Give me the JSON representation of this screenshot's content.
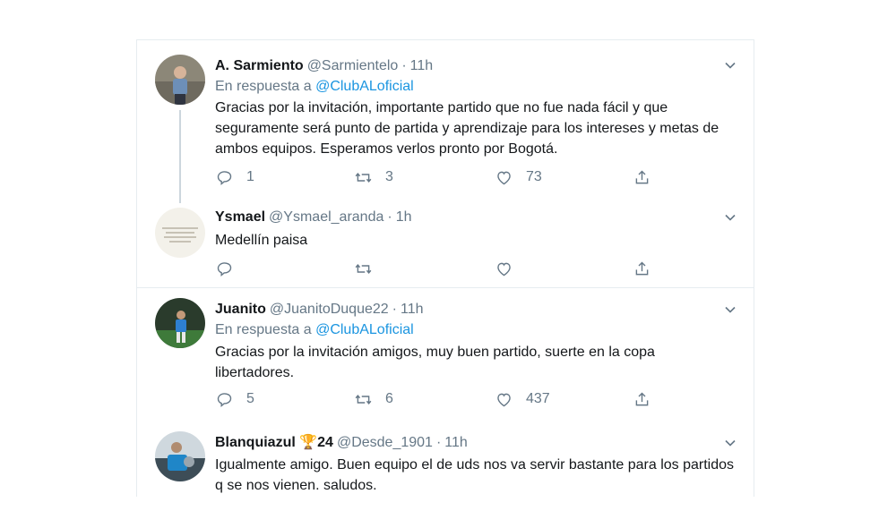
{
  "tweets": [
    {
      "name": "A. Sarmiento",
      "handle": "@Sarmientelo",
      "time": "11h",
      "reply_prefix": "En respuesta a",
      "reply_to": "@ClubALoficial",
      "text": "Gracias por la invitación, importante partido que no fue nada fácil y que seguramente será punto de partida y aprendizaje para los intereses y metas de ambos equipos. Esperamos verlos pronto por Bogotá.",
      "replies": "1",
      "retweets": "3",
      "likes": "73"
    },
    {
      "name": "Ysmael",
      "handle": "@Ysmael_aranda",
      "time": "1h",
      "text": "Medellín paisa",
      "replies": "",
      "retweets": "",
      "likes": ""
    },
    {
      "name": "Juanito",
      "handle": "@JuanitoDuque22",
      "time": "11h",
      "reply_prefix": "En respuesta a",
      "reply_to": "@ClubALoficial",
      "text": "Gracias por la invitación amigos, muy buen partido, suerte en la copa libertadores.",
      "replies": "5",
      "retweets": "6",
      "likes": "437"
    },
    {
      "name": "Blanquiazul",
      "name_badge": "🏆",
      "name_suffix": "24",
      "handle": "@Desde_1901",
      "time": "11h",
      "text": "Igualmente amigo. Buen equipo el de uds nos va servir bastante para los partidos q se nos vienen. saludos."
    }
  ],
  "icons": {
    "reply": "reply-icon",
    "retweet": "retweet-icon",
    "like": "heart-icon",
    "share": "share-icon",
    "more": "chevron-down-icon"
  },
  "colors": {
    "link": "#1b95e0",
    "secondary_text": "#657786",
    "border": "#e6ecf0"
  }
}
